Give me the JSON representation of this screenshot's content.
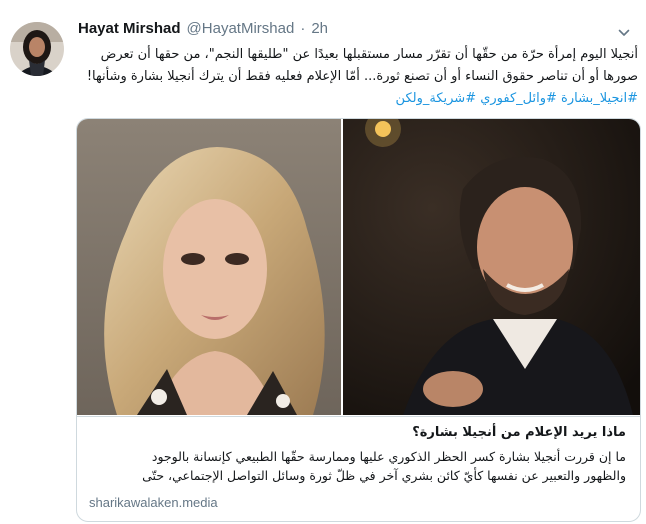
{
  "tweet": {
    "author_name": "Hayat Mirshad",
    "author_handle": "@HayatMirshad",
    "separator": "·",
    "timestamp": "2h",
    "text_lines": [
      "أنجيلا اليوم إمرأة حرّة من حقّها أن تقرّر مسار مستقبلها بعيدًا عن \"طليقها النجم\"، من حقها أن تعرض",
      "صورها أو أن تناصر حقوق النساء أو أن تصنع ثورة... أمّا الإعلام فعليه فقط أن يترك أنجيلا بشارة وشأنها!"
    ],
    "hashtags": "#انجيلا_بشارة #وائل_كفوري #شريكة_ولكن"
  },
  "card": {
    "title": "ماذا يريد الإعلام من أنجيلا بشارة؟",
    "description_lines": [
      "ما إن قررت أنجيلا بشارة كسر الحظر الذكوري عليها وممارسة حقّها الطبيعي كإنسانة بالوجود",
      "والظهور والتعبير عن نفسها كأيّ كائن بشري آخر في ظلّ ثورة وسائل التواصل الإجتماعي، حتّى"
    ],
    "domain": "sharikawalaken.media"
  },
  "colors": {
    "link": "#1b95e0",
    "secondary_text": "#657786",
    "border": "#cfd9de"
  },
  "icons": {
    "menu": "chevron-down-icon"
  }
}
